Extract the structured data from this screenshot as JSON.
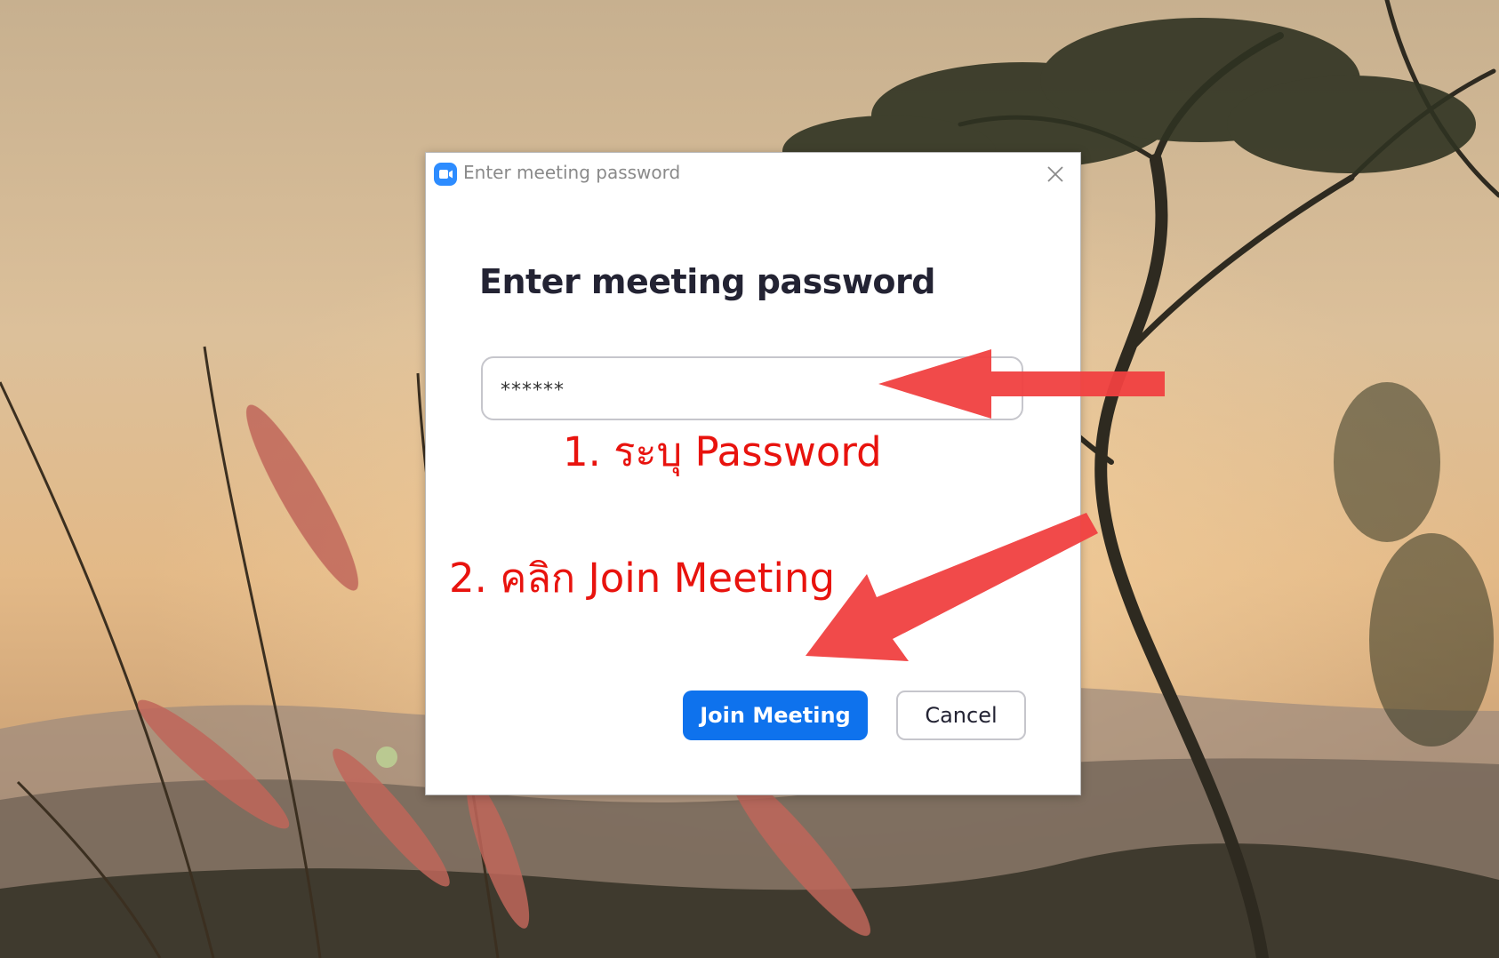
{
  "window": {
    "title": "Enter meeting password",
    "app_icon": "zoom-camera-icon",
    "close_icon": "close-icon"
  },
  "dialog": {
    "heading": "Enter meeting password",
    "password_value": "******",
    "join_label": "Join Meeting",
    "cancel_label": "Cancel"
  },
  "annotations": {
    "step1": "1. ระบุ Password",
    "step2": "2. คลิก Join Meeting",
    "color": "#e8130e"
  },
  "colors": {
    "join_button": "#0e72ed",
    "app_icon": "#2d8cff",
    "arrow": "#f04040"
  }
}
